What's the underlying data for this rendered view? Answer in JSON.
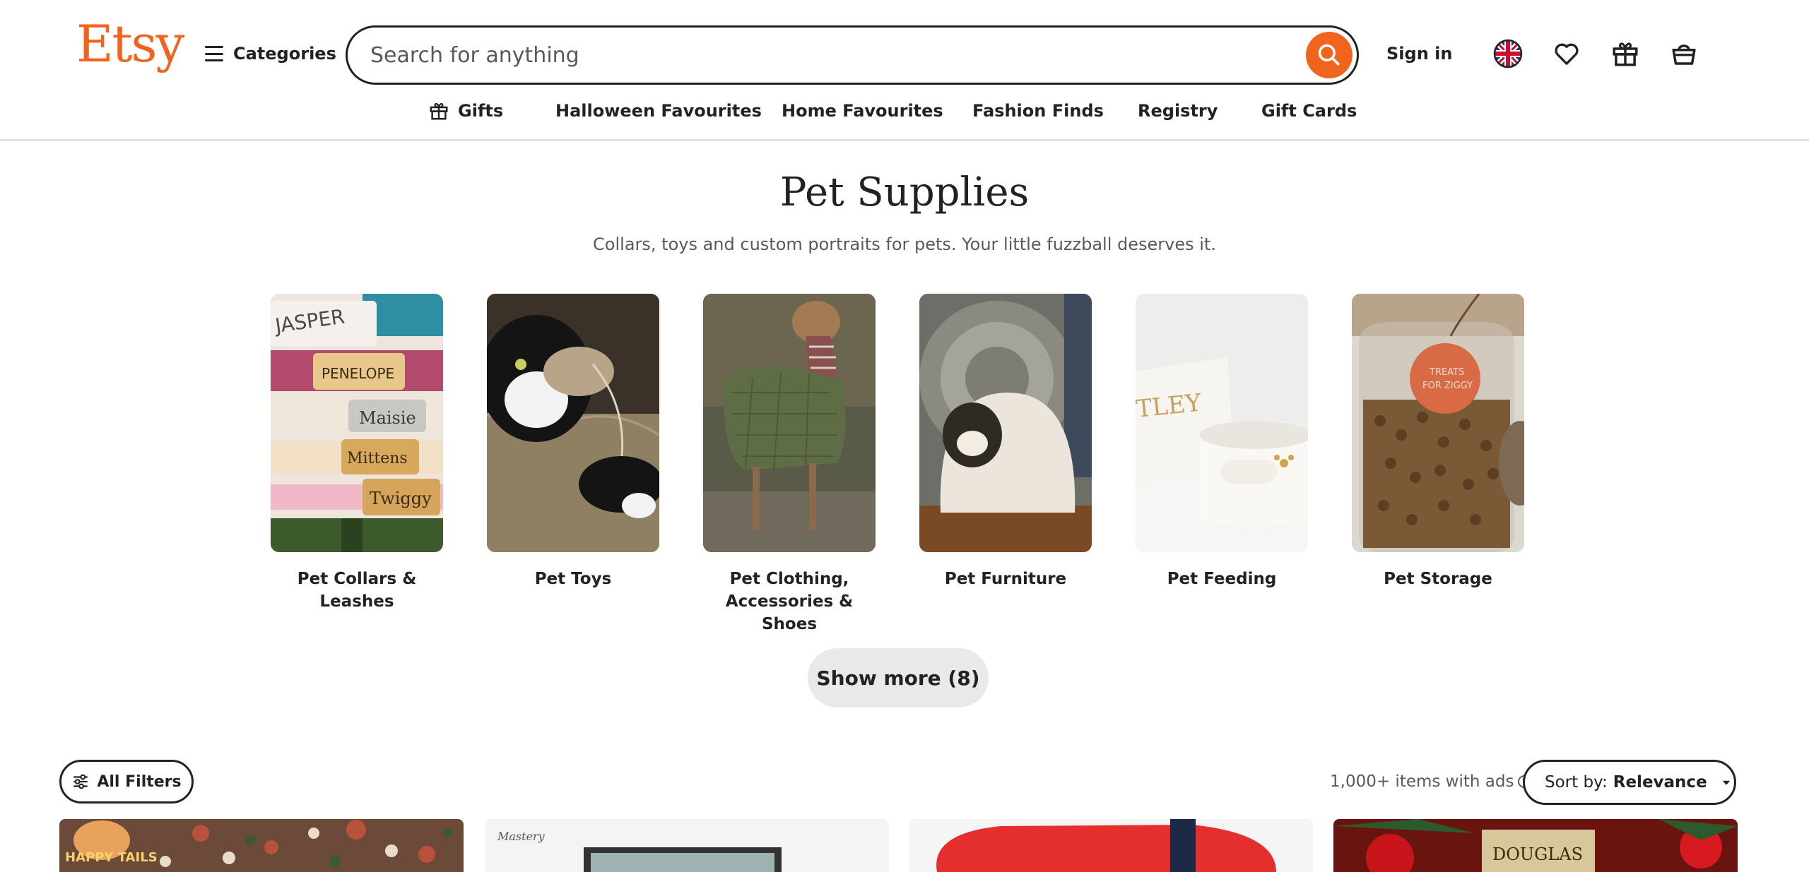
{
  "header": {
    "logo": "Etsy",
    "categories_label": "Categories",
    "search": {
      "placeholder": "Search for anything",
      "value": ""
    },
    "sign_in": "Sign in",
    "icons": [
      "uk-flag-icon",
      "heart-icon",
      "gift-icon",
      "shopping-bag-icon"
    ]
  },
  "subnav": {
    "items": [
      {
        "label": "Gifts",
        "icon": "gift-icon"
      },
      {
        "label": "Halloween Favourites"
      },
      {
        "label": "Home Favourites"
      },
      {
        "label": "Fashion Finds"
      },
      {
        "label": "Registry"
      },
      {
        "label": "Gift Cards"
      }
    ]
  },
  "page": {
    "title": "Pet Supplies",
    "subtitle": "Collars, toys and custom portraits for pets. Your little fuzzball deserves it."
  },
  "categories": [
    {
      "label": "Pet Collars & Leashes"
    },
    {
      "label": "Pet Toys"
    },
    {
      "label": "Pet Clothing, Accessories & Shoes"
    },
    {
      "label": "Pet Furniture"
    },
    {
      "label": "Pet Feeding"
    },
    {
      "label": "Pet Storage"
    }
  ],
  "category_image_text": {
    "collars": [
      "JASPER",
      "PENELOPE",
      "Maisie",
      "Mittens",
      "Twiggy"
    ],
    "feeding": "TLEY",
    "storage": [
      "TREATS",
      "FOR ZIGGY"
    ]
  },
  "show_more": "Show more (8)",
  "filters": {
    "all_filters": "All Filters",
    "items_count": "1,000+ items with ads",
    "help": "?",
    "sort_prefix": "Sort by:",
    "sort_value": "Relevance"
  },
  "listing_image_text": {
    "listing_1": "HAPPY TAILS",
    "listing_2": "Mastery",
    "listing_4": "DOUGLAS"
  },
  "colors": {
    "brand": "#f1641e",
    "text": "#222222",
    "muted": "#595959",
    "divider": "#e1e3df",
    "button_gray": "#e9e9e9"
  }
}
